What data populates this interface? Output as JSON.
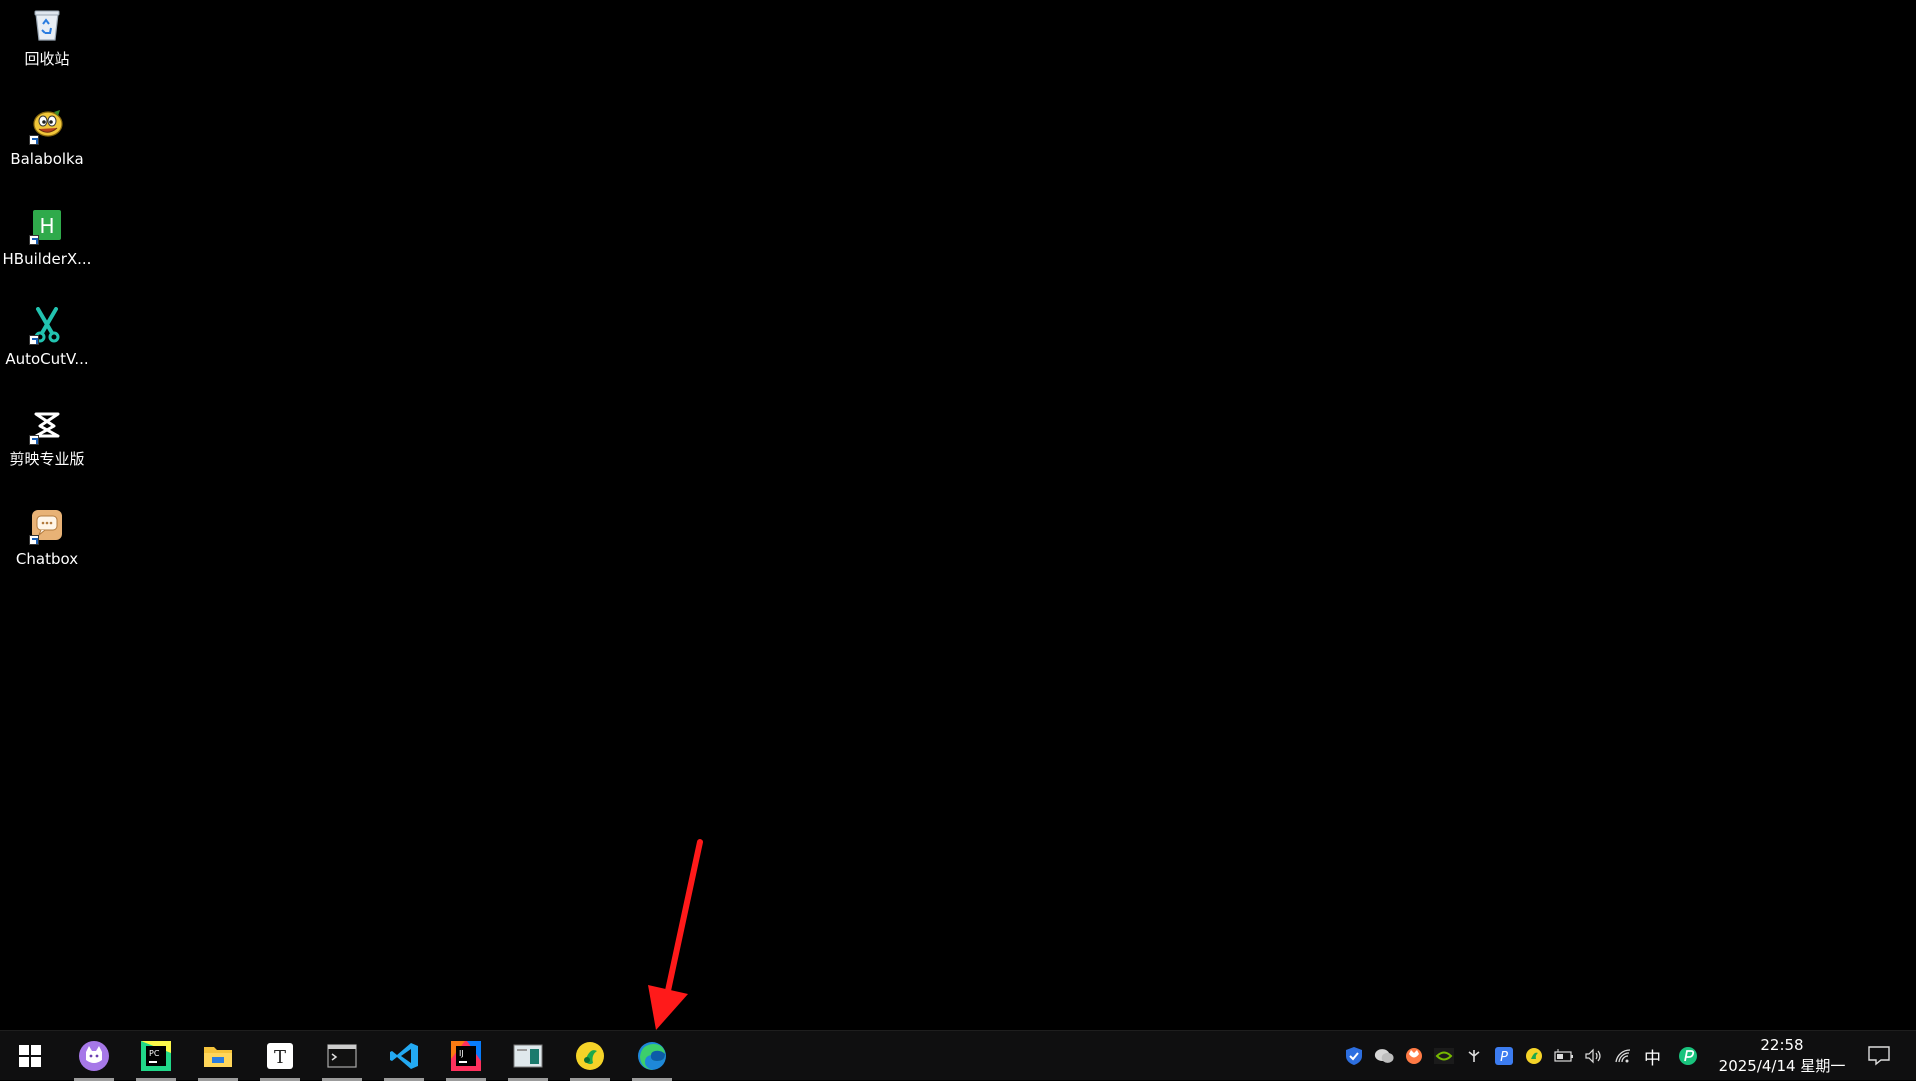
{
  "desktop": {
    "icons": [
      {
        "label": "回收站",
        "icon": "recycle-bin-icon"
      },
      {
        "label": "Balabolka",
        "icon": "balabolka-icon"
      },
      {
        "label": "HBuilderX...",
        "icon": "hbuilderx-icon"
      },
      {
        "label": "AutoCutV...",
        "icon": "autocut-icon"
      },
      {
        "label": "剪映专业版",
        "icon": "capcut-icon"
      },
      {
        "label": "Chatbox",
        "icon": "chatbox-icon"
      }
    ]
  },
  "taskbar": {
    "apps": [
      {
        "name": "start",
        "icon": "windows-start-icon",
        "pinned": false
      },
      {
        "name": "cat-app",
        "icon": "cat-app-icon",
        "running": true
      },
      {
        "name": "pycharm",
        "icon": "pycharm-icon",
        "running": true
      },
      {
        "name": "file-explorer",
        "icon": "folder-icon",
        "running": true
      },
      {
        "name": "typora",
        "icon": "typora-icon",
        "running": true
      },
      {
        "name": "terminal",
        "icon": "terminal-icon",
        "running": true
      },
      {
        "name": "vscode",
        "icon": "vscode-icon",
        "running": true
      },
      {
        "name": "intellij",
        "icon": "intellij-icon",
        "running": true
      },
      {
        "name": "app-window",
        "icon": "window-app-icon",
        "running": true
      },
      {
        "name": "music",
        "icon": "music-icon",
        "running": true
      },
      {
        "name": "edge",
        "icon": "edge-icon",
        "running": true
      }
    ],
    "tray": {
      "ime": "中",
      "time": "22:58",
      "date": "2025/4/14 星期一"
    }
  },
  "colors": {
    "desktop_bg": "#000000",
    "taskbar_bg": "#0f0f10",
    "annotation_arrow": "#ff1a1a"
  }
}
